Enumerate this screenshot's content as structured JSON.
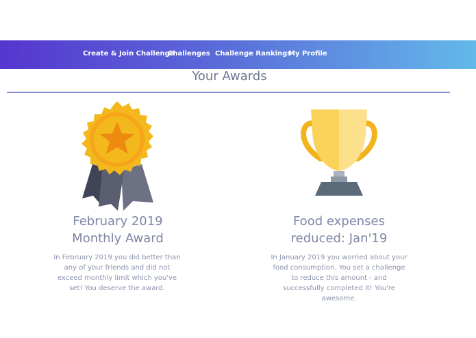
{
  "nav": {
    "items": [
      {
        "label": "Create & Join Challenge"
      },
      {
        "label": "Challenges"
      },
      {
        "label": "Challenge Rankings"
      },
      {
        "label": "My Profile"
      }
    ]
  },
  "page": {
    "title": "Your Awards"
  },
  "awards": [
    {
      "icon": "medal-ribbon-icon",
      "title_line1": "February 2019",
      "title_line2": "Monthly Award",
      "description": "In February 2019 you did better than any of your friends and did not exceed monthly limit which you've set! You deserve the award."
    },
    {
      "icon": "trophy-icon",
      "title_line1": "Food expenses",
      "title_line2": "reduced: Jan'19",
      "description": "In January 2019 you worried about your food consumption. You set a challenge to reduce this amount - and successfully completed it! You're awesome."
    }
  ],
  "colors": {
    "nav_gradient_start": "#5536cf",
    "nav_gradient_end": "#63b9ea",
    "divider": "#8a8fd8",
    "medal_gold": "#f3b91c",
    "star": "#ef8a10",
    "trophy_gold": "#fbd25a",
    "trophy_base": "#5a6a78"
  }
}
